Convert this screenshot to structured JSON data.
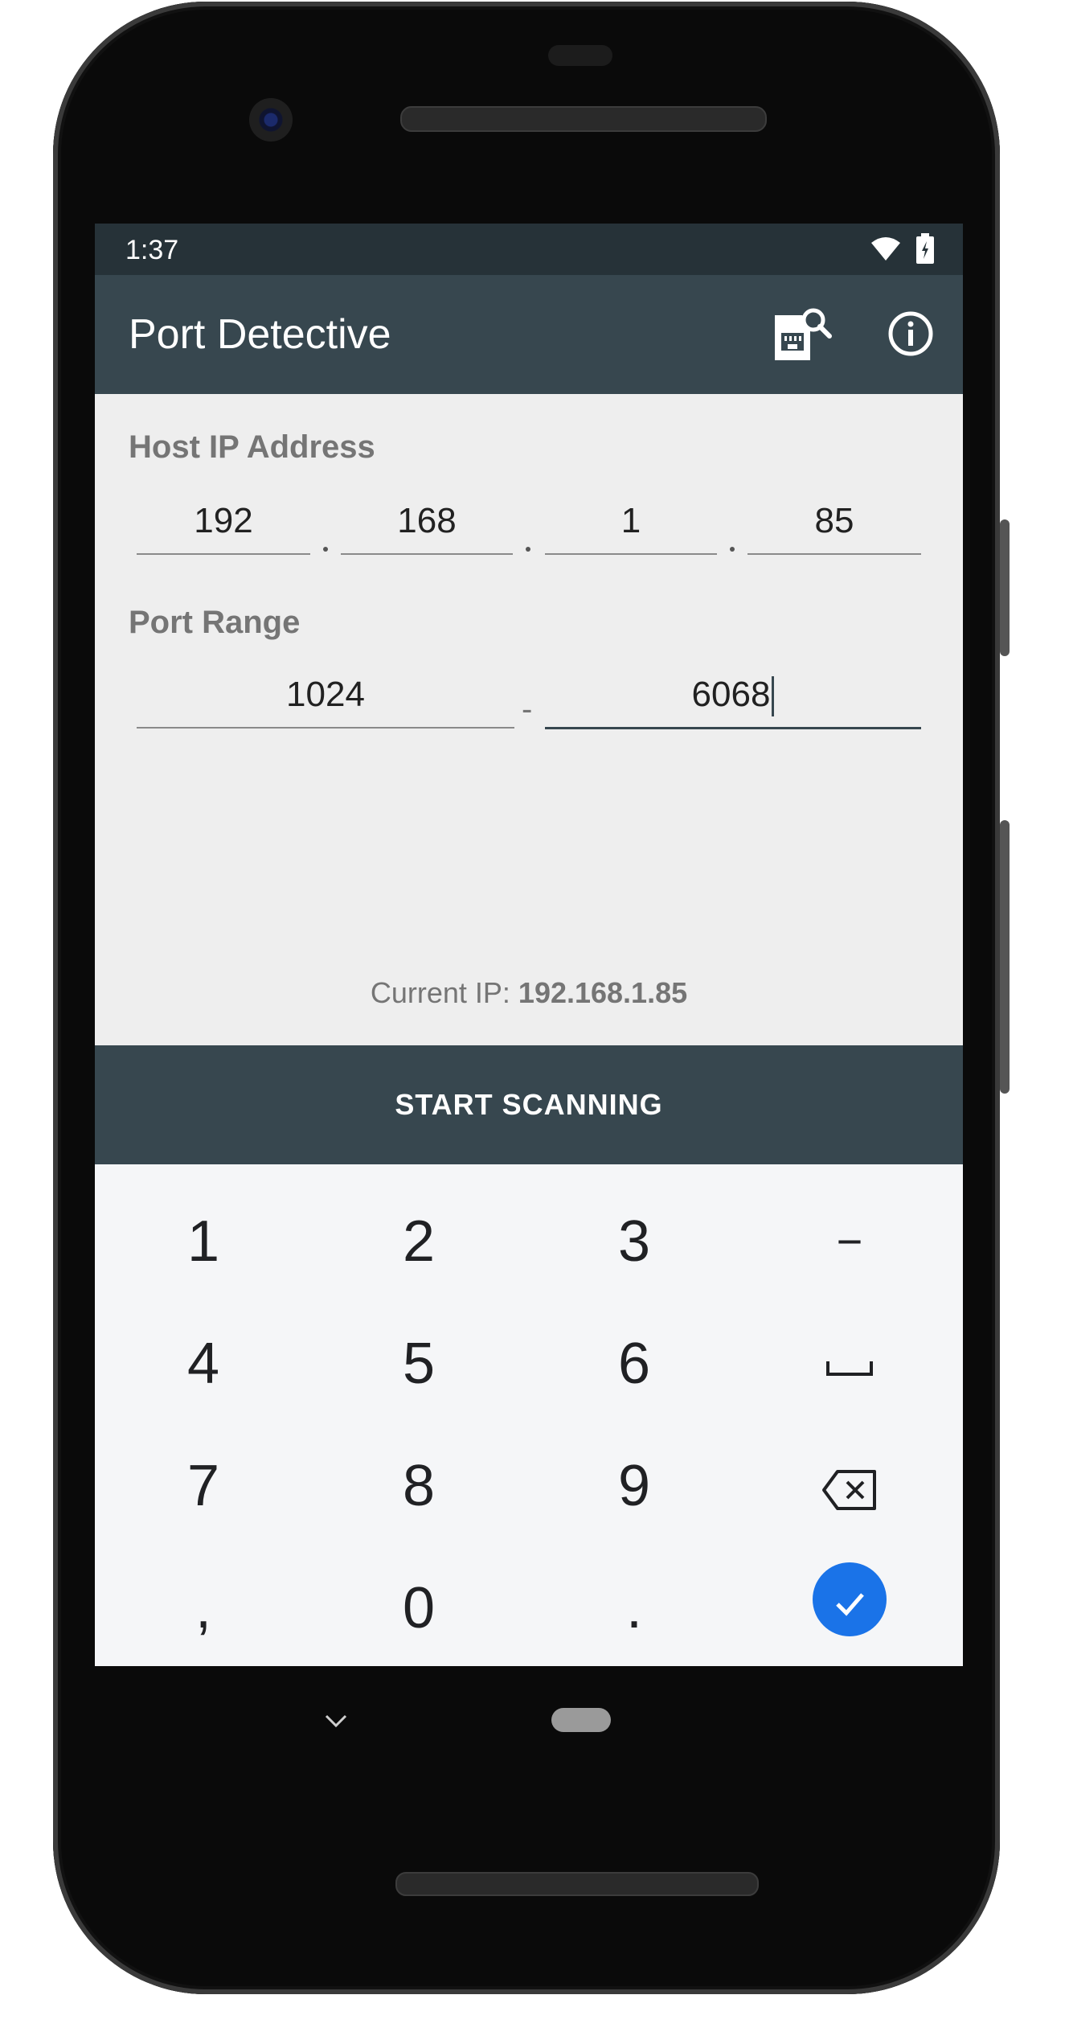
{
  "status_bar": {
    "time": "1:37"
  },
  "app_bar": {
    "title": "Port Detective",
    "scan_icon": "ethernet-search-icon",
    "info_icon": "info-icon"
  },
  "host": {
    "label": "Host IP Address",
    "octets": [
      "192",
      "168",
      "1",
      "85"
    ],
    "separator": "."
  },
  "port_range": {
    "label": "Port Range",
    "start": "1024",
    "end": "6068",
    "separator": "-"
  },
  "current_ip": {
    "prefix": "Current IP: ",
    "value": "192.168.1.85"
  },
  "scan_button": {
    "label": "START SCANNING"
  },
  "keyboard": {
    "keys": [
      [
        "1",
        "2",
        "3",
        "−"
      ],
      [
        "4",
        "5",
        "6",
        "space"
      ],
      [
        "7",
        "8",
        "9",
        "backspace"
      ],
      [
        ",",
        "0",
        ".",
        "done"
      ]
    ]
  },
  "colors": {
    "primary": "#37474f",
    "status_bar": "#263238",
    "accent": "#1a73e8",
    "background": "#eeeeee"
  }
}
